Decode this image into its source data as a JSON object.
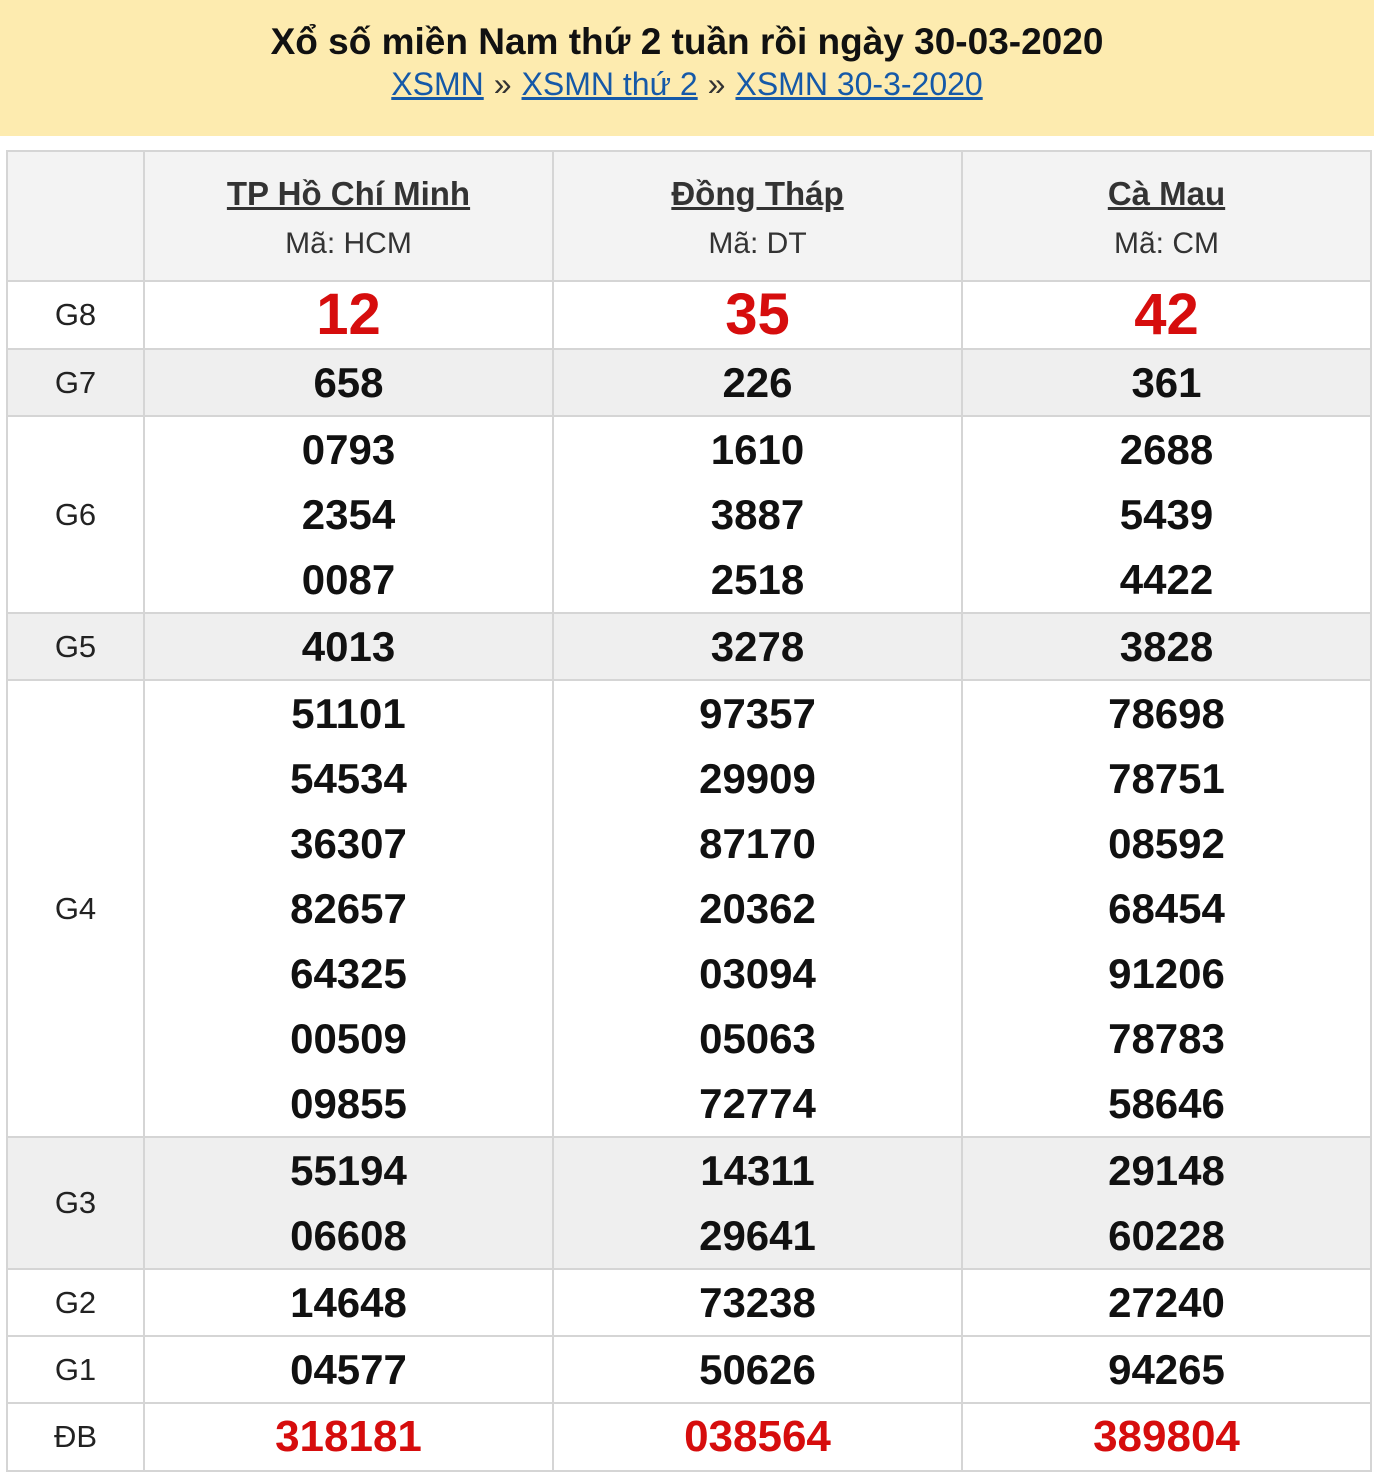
{
  "header": {
    "title": "Xổ số miền Nam thứ 2 tuần rồi ngày 30-03-2020",
    "breadcrumb": [
      {
        "label": "XSMN"
      },
      {
        "label": "XSMN thứ 2"
      },
      {
        "label": "XSMN 30-3-2020"
      }
    ],
    "separator": "»"
  },
  "provinces": [
    {
      "name": "TP Hồ Chí Minh",
      "code": "Mã: HCM"
    },
    {
      "name": "Đồng Tháp",
      "code": "Mã: DT"
    },
    {
      "name": "Cà Mau",
      "code": "Mã: CM"
    }
  ],
  "prizes": [
    {
      "label": "G8",
      "values": [
        [
          "12"
        ],
        [
          "35"
        ],
        [
          "42"
        ]
      ]
    },
    {
      "label": "G7",
      "values": [
        [
          "658"
        ],
        [
          "226"
        ],
        [
          "361"
        ]
      ]
    },
    {
      "label": "G6",
      "values": [
        [
          "0793",
          "2354",
          "0087"
        ],
        [
          "1610",
          "3887",
          "2518"
        ],
        [
          "2688",
          "5439",
          "4422"
        ]
      ]
    },
    {
      "label": "G5",
      "values": [
        [
          "4013"
        ],
        [
          "3278"
        ],
        [
          "3828"
        ]
      ]
    },
    {
      "label": "G4",
      "values": [
        [
          "51101",
          "54534",
          "36307",
          "82657",
          "64325",
          "00509",
          "09855"
        ],
        [
          "97357",
          "29909",
          "87170",
          "20362",
          "03094",
          "05063",
          "72774"
        ],
        [
          "78698",
          "78751",
          "08592",
          "68454",
          "91206",
          "78783",
          "58646"
        ]
      ]
    },
    {
      "label": "G3",
      "values": [
        [
          "55194",
          "06608"
        ],
        [
          "14311",
          "29641"
        ],
        [
          "29148",
          "60228"
        ]
      ]
    },
    {
      "label": "G2",
      "values": [
        [
          "14648"
        ],
        [
          "73238"
        ],
        [
          "27240"
        ]
      ]
    },
    {
      "label": "G1",
      "values": [
        [
          "04577"
        ],
        [
          "50626"
        ],
        [
          "94265"
        ]
      ]
    },
    {
      "label": "ĐB",
      "values": [
        [
          "318181"
        ],
        [
          "038564"
        ],
        [
          "389804"
        ]
      ]
    }
  ],
  "colors": {
    "header_bg": "#fdebaf",
    "link": "#1559a8",
    "highlight": "#d60d0d",
    "alt_row": "#efefef"
  }
}
